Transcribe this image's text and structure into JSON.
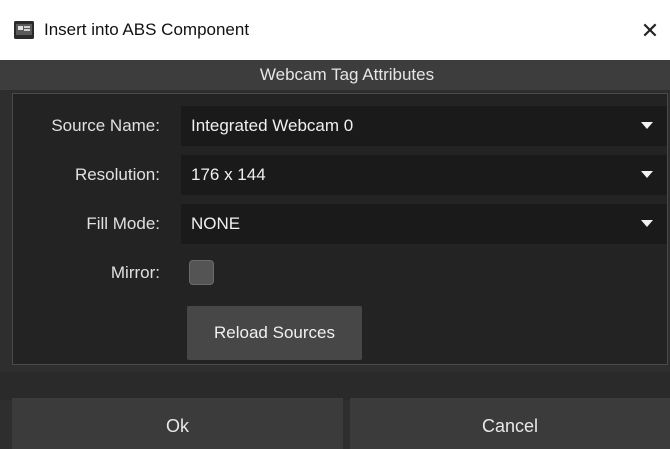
{
  "window": {
    "title": "Insert into ABS Component",
    "close_glyph": "✕",
    "icon": "abs-app-icon"
  },
  "section": {
    "header": "Webcam Tag Attributes"
  },
  "form": {
    "source_name": {
      "label": "Source Name:",
      "value": "Integrated Webcam 0"
    },
    "resolution": {
      "label": "Resolution:",
      "value": "176 x 144"
    },
    "fill_mode": {
      "label": "Fill Mode:",
      "value": "NONE"
    },
    "mirror": {
      "label": "Mirror:",
      "checked": false
    },
    "reload_label": "Reload Sources"
  },
  "footer": {
    "ok_label": "Ok",
    "cancel_label": "Cancel"
  },
  "colors": {
    "background": "#2e2e2e",
    "panel": "#232323",
    "field": "#1a1a1a",
    "button": "#3b3b3b",
    "text": "#e8e8e8"
  }
}
